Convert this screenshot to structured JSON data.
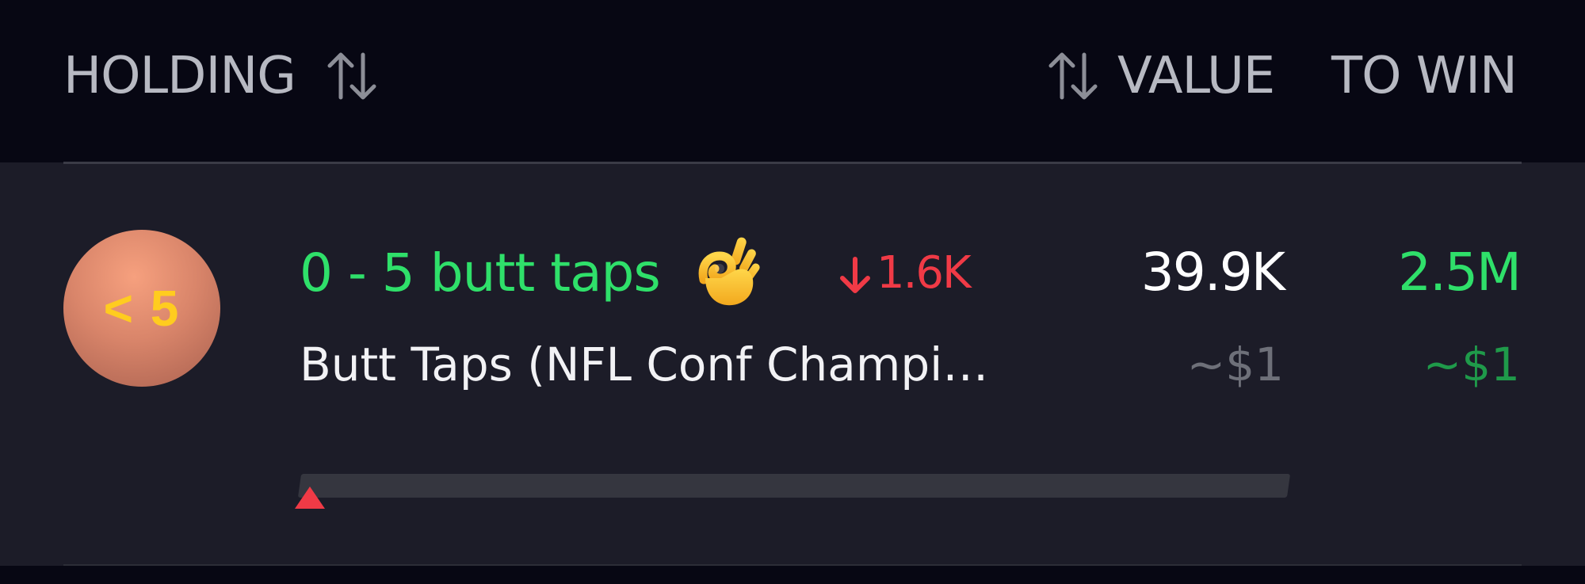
{
  "header": {
    "holding_label": "HOLDING",
    "value_label": "VALUE",
    "to_win_label": "TO WIN"
  },
  "position": {
    "badge_text": "< 5",
    "title": "0 - 5 butt taps",
    "title_emoji": "ok-hand-emoji",
    "change": "1.6K",
    "change_direction": "down",
    "value": "39.9K",
    "value_usd": "~$1",
    "to_win": "2.5M",
    "to_win_usd": "~$1",
    "subtitle": "Butt Taps (NFL Conf Champi…",
    "progress_percent": 0
  },
  "colors": {
    "background": "#070713",
    "row_background": "#1c1c28",
    "positive": "#2fe06a",
    "negative": "#f03a46",
    "muted": "#6e7079",
    "badge_text": "#ffcc1f"
  }
}
